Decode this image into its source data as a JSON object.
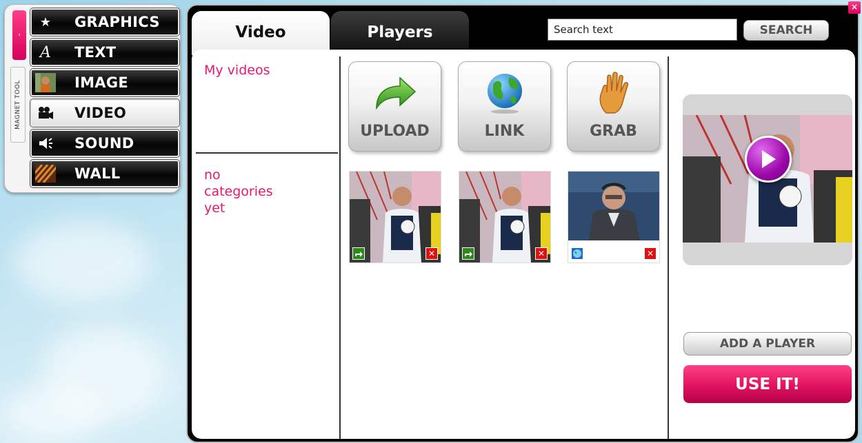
{
  "palette": {
    "handle_glyph": "‹",
    "vertical_label": "MAGNET TOOL",
    "tools": [
      {
        "label": "GRAPHICS",
        "icon": "star-icon"
      },
      {
        "label": "TEXT",
        "icon": "text-icon"
      },
      {
        "label": "IMAGE",
        "icon": "image-icon"
      },
      {
        "label": "VIDEO",
        "icon": "film-camera-icon",
        "active": true
      },
      {
        "label": "SOUND",
        "icon": "speaker-icon"
      },
      {
        "label": "WALL",
        "icon": "wall-icon"
      }
    ]
  },
  "window": {
    "close_glyph": "×",
    "tabs": [
      {
        "label": "Video",
        "active": true
      },
      {
        "label": "Players",
        "active": false
      }
    ],
    "search": {
      "value": "Search text",
      "button_label": "SEARCH"
    }
  },
  "categories": {
    "my_videos": "My videos",
    "empty_message": "no categories yet"
  },
  "actions": [
    {
      "label": "UPLOAD",
      "icon": "green-arrow-icon"
    },
    {
      "label": "LINK",
      "icon": "globe-icon"
    },
    {
      "label": "GRAB",
      "icon": "hand-icon"
    }
  ],
  "videos": [
    {
      "name": "video-thumbnail-1",
      "source_icon": "upload-badge-icon"
    },
    {
      "name": "video-thumbnail-2",
      "source_icon": "upload-badge-icon"
    },
    {
      "name": "video-thumbnail-3",
      "source_icon": "link-badge-icon"
    }
  ],
  "player": {
    "add_player_label": "ADD A PLAYER",
    "use_it_label": "USE IT!"
  },
  "colors": {
    "accent_pink": "#e8176e",
    "active_tool_bg": "#ffffff",
    "tool_bg": "#000000"
  }
}
